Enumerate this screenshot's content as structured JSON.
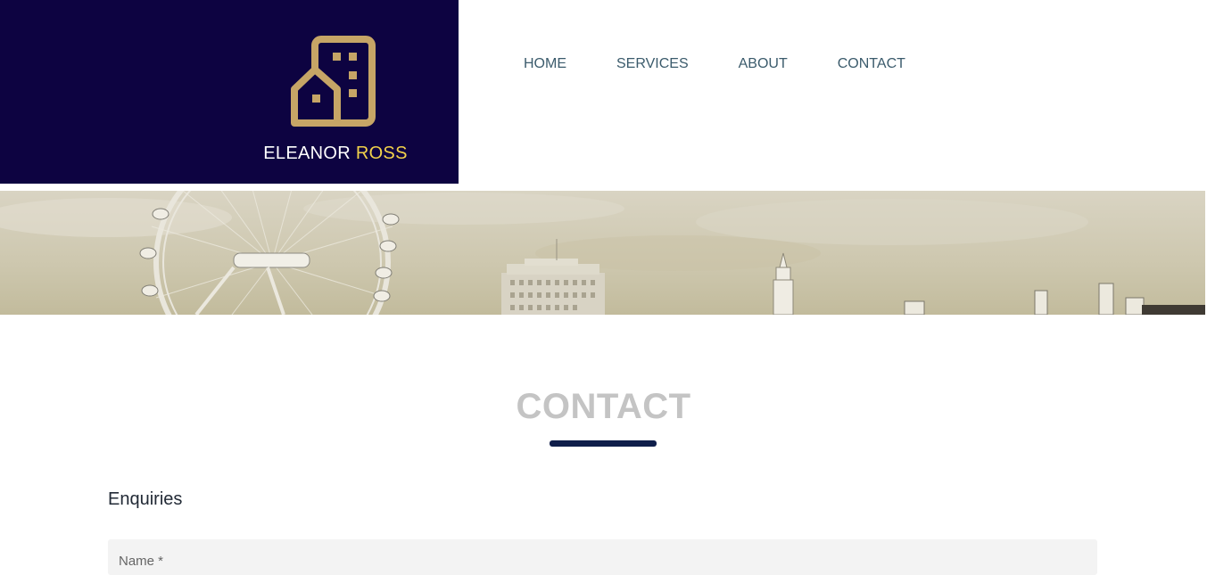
{
  "brand": {
    "first_name": "ELEANOR",
    "last_name": "ROSS",
    "logo_icon": "building-icon",
    "colors": {
      "background": "#0d0341",
      "logo": "#c6a566",
      "accent": "#f2d24b"
    }
  },
  "nav": {
    "items": [
      {
        "label": "HOME"
      },
      {
        "label": "SERVICES"
      },
      {
        "label": "ABOUT"
      },
      {
        "label": "CONTACT"
      }
    ]
  },
  "hero": {
    "description_icon": "london-skyline-image"
  },
  "contact": {
    "title": "CONTACT",
    "form_heading": "Enquiries",
    "name_placeholder": "Name *"
  }
}
